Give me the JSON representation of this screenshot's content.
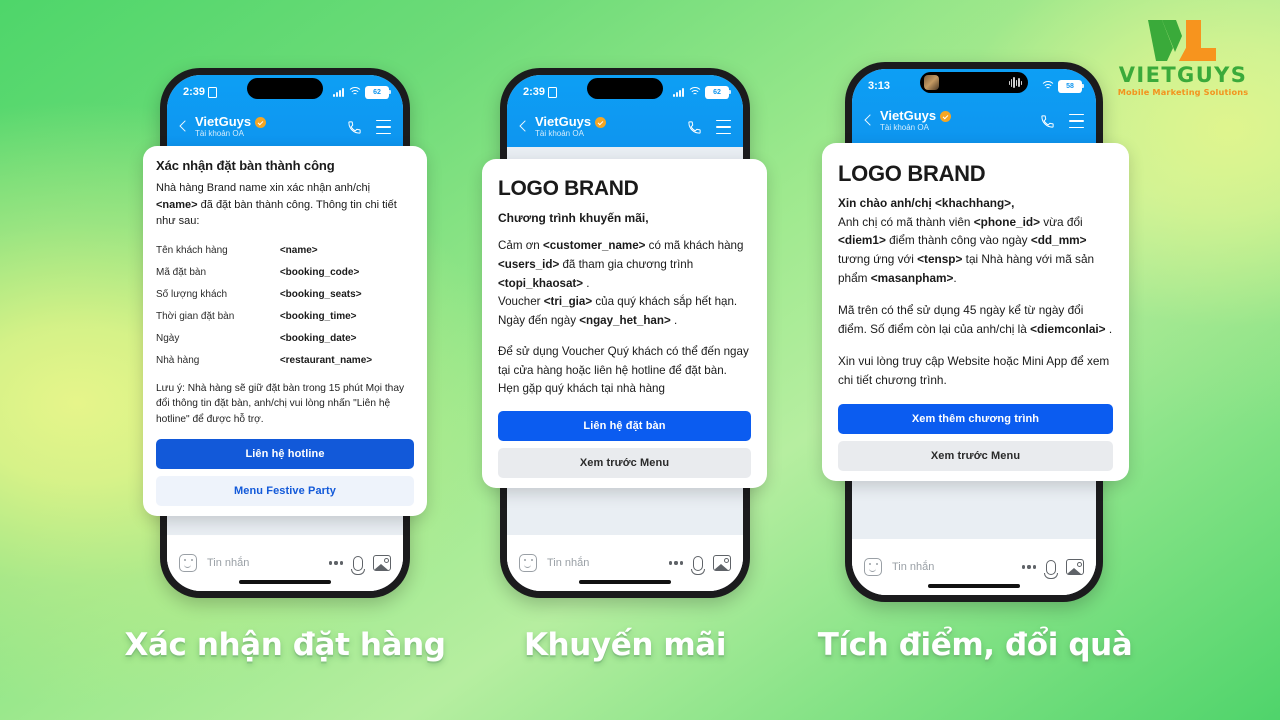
{
  "logo": {
    "wordmark": "VIETGUYS",
    "tagline": "Mobile Marketing Solutions",
    "mark_colors": {
      "green": "#3aaa3a",
      "orange": "#f3931e"
    }
  },
  "background": {
    "gradient_from": "#4ed66a",
    "gradient_mid": "#d9f391",
    "gradient_to": "#4fd46b"
  },
  "phones": [
    {
      "status": {
        "time": "2:39",
        "battery": "62",
        "has_sim": true,
        "has_wifi": true
      },
      "header": {
        "name": "VietGuys",
        "subtitle": "Tài khoản OA",
        "verified": true
      },
      "input": {
        "placeholder": "Tin nhắn"
      },
      "card": {
        "title": "Xác nhận đặt bàn thành công",
        "lead_before": "Nhà hàng Brand name xin xác nhận anh/chị ",
        "lead_bold": "<name>",
        "lead_after": " đã đặt bàn thành công. Thông tin chi tiết như sau:",
        "rows": [
          {
            "key": "Tên khách hàng",
            "value": "<name>"
          },
          {
            "key": "Mã đặt bàn",
            "value": "<booking_code>"
          },
          {
            "key": "Số lượng khách",
            "value": "<booking_seats>"
          },
          {
            "key": "Thời gian đặt bàn",
            "value": "<booking_time>"
          },
          {
            "key": "Ngày",
            "value": "<booking_date>"
          },
          {
            "key": "Nhà hàng",
            "value": "<restaurant_name>"
          }
        ],
        "note": "Lưu ý: Nhà hàng sẽ giữ đặt bàn trong 15 phút Mọi thay đổi thông tin đặt bàn, anh/chị vui lòng nhấn \"Liên hệ hotline\" để được hỗ trợ.",
        "primary_button": "Liên hệ hotline",
        "secondary_button": "Menu Festive Party"
      },
      "caption": "Xác nhận đặt hàng"
    },
    {
      "status": {
        "time": "2:39",
        "battery": "62",
        "has_sim": true,
        "has_wifi": true
      },
      "header": {
        "name": "VietGuys",
        "subtitle": "Tài khoản OA",
        "verified": true
      },
      "input": {
        "placeholder": "Tin nhắn"
      },
      "card": {
        "brand": "LOGO BRAND",
        "subtitle": "Chương trình khuyến mãi,",
        "paragraph1_parts": [
          {
            "text": "Cảm ơn ",
            "bold": false
          },
          {
            "text": "<customer_name>",
            "bold": true
          },
          {
            "text": " có mã khách hàng ",
            "bold": false
          },
          {
            "text": "<users_id>",
            "bold": true
          },
          {
            "text": " đã tham gia chương trình ",
            "bold": false
          },
          {
            "text": "<topi_khaosat>",
            "bold": true
          },
          {
            "text": " .",
            "bold": false
          },
          {
            "text": "\nVoucher ",
            "bold": false
          },
          {
            "text": "<tri_gia>",
            "bold": true
          },
          {
            "text": " của quý khách sắp hết hạn. Ngày đến ngày ",
            "bold": false
          },
          {
            "text": "<ngay_het_han>",
            "bold": true
          },
          {
            "text": " .",
            "bold": false
          }
        ],
        "paragraph2": "Để sử dụng Voucher Quý khách có thể đến ngay tại cửa hàng hoặc liên hệ hotline để đặt bàn.\nHẹn gặp quý khách tại nhà hàng",
        "primary_button": "Liên hệ đặt bàn",
        "secondary_button": "Xem trước Menu"
      },
      "caption": "Khuyến mãi"
    },
    {
      "status": {
        "time": "3:13",
        "battery": "58",
        "has_sim": false,
        "has_wifi": true,
        "dynamic_island_activity": true
      },
      "header": {
        "name": "VietGuys",
        "subtitle": "Tài khoản OA",
        "verified": true
      },
      "input": {
        "placeholder": "Tin nhắn"
      },
      "card": {
        "brand": "LOGO BRAND",
        "greeting_parts": [
          {
            "text": "Xin chào anh/chị <khachhang>,",
            "bold": true
          }
        ],
        "paragraph1_parts": [
          {
            "text": "Anh chị có mã thành viên ",
            "bold": false
          },
          {
            "text": "<phone_id>",
            "bold": true
          },
          {
            "text": " vừa đổi ",
            "bold": false
          },
          {
            "text": "<diem1>",
            "bold": true
          },
          {
            "text": " điểm thành công vào ngày ",
            "bold": false
          },
          {
            "text": "<dd_mm>",
            "bold": true
          },
          {
            "text": " tương ứng với ",
            "bold": false
          },
          {
            "text": "<tensp>",
            "bold": true
          },
          {
            "text": " tại Nhà hàng với mã sản phẩm ",
            "bold": false
          },
          {
            "text": "<masanpham>",
            "bold": true
          },
          {
            "text": ".",
            "bold": false
          }
        ],
        "paragraph2_parts": [
          {
            "text": "Mã trên có thể sử dụng 45 ngày kể từ ngày đổi điểm. Số điểm còn lại của anh/chị là ",
            "bold": false
          },
          {
            "text": "<diemconlai>",
            "bold": true
          },
          {
            "text": " .",
            "bold": false
          }
        ],
        "paragraph3": "Xin vui lòng truy cập Website hoặc Mini App để xem chi tiết chương trình.",
        "primary_button": "Xem thêm chương trình",
        "secondary_button": "Xem trước Menu"
      },
      "caption": "Tích điểm, đổi quà"
    }
  ]
}
